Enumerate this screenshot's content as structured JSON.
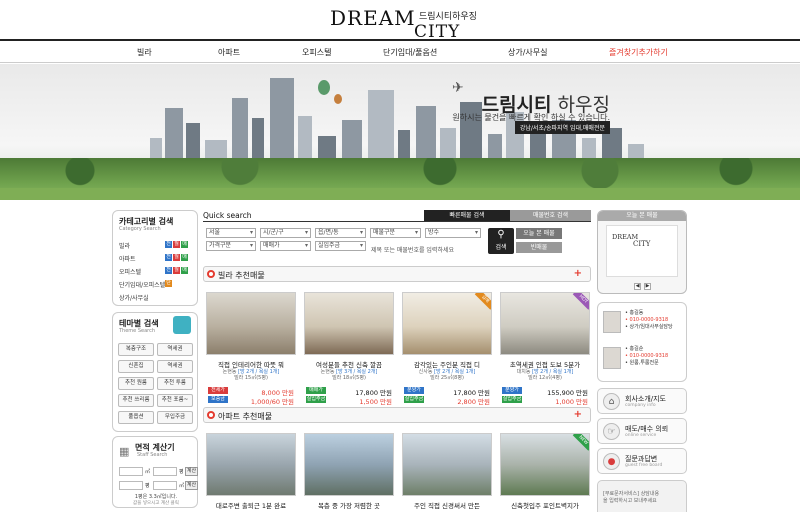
{
  "header": {
    "logo_dream": "DREAM",
    "logo_city": "CITY",
    "logo_sub": "드림시티하우징"
  },
  "nav": {
    "items": [
      {
        "label": "빌라",
        "accent": false
      },
      {
        "label": "아파트",
        "accent": false
      },
      {
        "label": "오피스텔",
        "accent": false
      },
      {
        "label": "단기임대/풀옵션",
        "accent": false
      },
      {
        "label": "상가/사무실",
        "accent": false
      },
      {
        "label": "즐겨찾기추가하기",
        "accent": true
      }
    ]
  },
  "banner": {
    "title_bold": "드림시티",
    "title_thin": " 하우징",
    "subtitle": "원하시는 물건을 빠르게 확인 하실 수 있습니다.",
    "tag": "강남/서초/송파지역 임대,매매전문"
  },
  "category": {
    "title": "카테고리별 검색",
    "subtitle": "Category Search",
    "items": [
      "빌라",
      "아파트",
      "오피스텔",
      "단기임대/오피스텔",
      "상가/사무실"
    ],
    "badges": [
      "전",
      "월",
      "매",
      "단"
    ],
    "badge_colors": [
      "#2f74c8",
      "#d93c3c",
      "#2fa04a",
      "#e28a1e"
    ]
  },
  "theme": {
    "title": "테마별 검색",
    "subtitle": "Theme Search",
    "buttons": [
      "복층구조",
      "역세권",
      "신혼집",
      "역세권",
      "추천 원룸",
      "추천 투룸",
      "추천 쓰리룸",
      "추천 포룸~",
      "풀옵션",
      "무입주금"
    ]
  },
  "calc": {
    "title": "면적 계산기",
    "subtitle": "Staff Search",
    "row1_unit1": "㎡",
    "row1_unit2": "평",
    "row1_btn": "계산",
    "row2_unit1": "평",
    "row2_unit2": "㎡",
    "row2_btn": "계산",
    "note1": "1평은 3.3㎡입니다.",
    "note2": "값을 넣으시고 계산 클릭"
  },
  "quick_search": {
    "title": "Quick search",
    "tab_active": "빠른매물 검색",
    "tab_inactive": "매물번호 검색",
    "row1": [
      "서울",
      "시/군/구",
      "읍/면/동",
      "매물구분",
      "방수"
    ],
    "row2": [
      "가격구분",
      "매매가",
      "실입주금"
    ],
    "hint": "제목 또는 매물번호를 입력하세요",
    "search_label": "검색",
    "btn_today": "오늘 본 매물",
    "btn_reset": "빈매물"
  },
  "sections": {
    "villa_title": "빌라 추천매물",
    "apt_title": "아파트 추천매물",
    "plus": "+"
  },
  "villa_cards": [
    {
      "title": "직접 인테리어한 따뜻 뭐",
      "agent": "논현동",
      "type": "[방 2개 / 욕실 1개]",
      "area": "빌라 15㎡(5평)",
      "tags": [
        "전세가",
        "보증금"
      ],
      "tag_colors": [
        "#d93c3c",
        "#2f74c8"
      ],
      "prices": [
        "8,000 만원",
        "1,000/60 만원"
      ],
      "ribbon": "",
      "ribbon_color": ""
    },
    {
      "title": "여성분들 추천 신축 깔끔",
      "agent": "논현동",
      "type": "[방 3개 / 욕실 2개]",
      "area": "빌라 18㎡(5평)",
      "tags": [
        "매매가",
        "실입주금"
      ],
      "tag_colors": [
        "#2fa04a",
        "#2fa04a"
      ],
      "prices": [
        "17,800 만원",
        "1,500 만원"
      ],
      "ribbon": "",
      "ribbon_color": ""
    },
    {
      "title": "감각있는 주인분 직접 디",
      "agent": "신사동",
      "type": "[방 2개 / 욕실 1개]",
      "area": "빌라 25㎡(8평)",
      "tags": [
        "분양가",
        "실입주금"
      ],
      "tag_colors": [
        "#2f74c8",
        "#2fa04a"
      ],
      "prices": [
        "17,800 만원",
        "2,800 만원"
      ],
      "ribbon": "급매",
      "ribbon_color": "#e28a1e"
    },
    {
      "title": "초역세권 인접 도보 5분가",
      "agent": "대치동",
      "type": "[방 2개 / 욕실 1개]",
      "area": "빌라 12㎡(4평)",
      "tags": [
        "분양가",
        "실입주금"
      ],
      "tag_colors": [
        "#2f74c8",
        "#2fa04a"
      ],
      "prices": [
        "155,900 만원",
        "1,000 만원"
      ],
      "ribbon": "HOT",
      "ribbon_color": "#9b59b6"
    }
  ],
  "apt_cards": [
    {
      "title": "대로주변 출퇴근 1분 완료",
      "ribbon": "",
      "ribbon_color": ""
    },
    {
      "title": "복층 중 가장 저렴한 곳",
      "ribbon": "",
      "ribbon_color": ""
    },
    {
      "title": "주인 직접 신경써서 만든",
      "ribbon": "",
      "ribbon_color": ""
    },
    {
      "title": "신축첫입주 포인트벽지가",
      "ribbon": "NEW",
      "ribbon_color": "#2fa04a"
    }
  ],
  "right": {
    "today_title": "오늘 본 매물",
    "mini_dream": "DREAM",
    "mini_city": "CITY",
    "prev": "◀",
    "next": "▶",
    "agents": [
      {
        "name": "• 홍길동",
        "phone": "• 010-0000-9318",
        "dept": "• 상가/임대사무실담당"
      },
      {
        "name": "• 홍길순",
        "phone": "• 010-0000-9318",
        "dept": "• 원룸,투룸전문"
      }
    ],
    "services": [
      {
        "title": "회사소개/지도",
        "sub": "company info",
        "icon": "⌂"
      },
      {
        "title": "매도/매수 의뢰",
        "sub": "online service",
        "icon": "☞"
      },
      {
        "title": "질문과답변",
        "sub": "guest free board",
        "icon": "●"
      }
    ],
    "board_lines": [
      "[무료문자서비스] 상담내용",
      "을 입력하시고 보내주세요"
    ]
  }
}
